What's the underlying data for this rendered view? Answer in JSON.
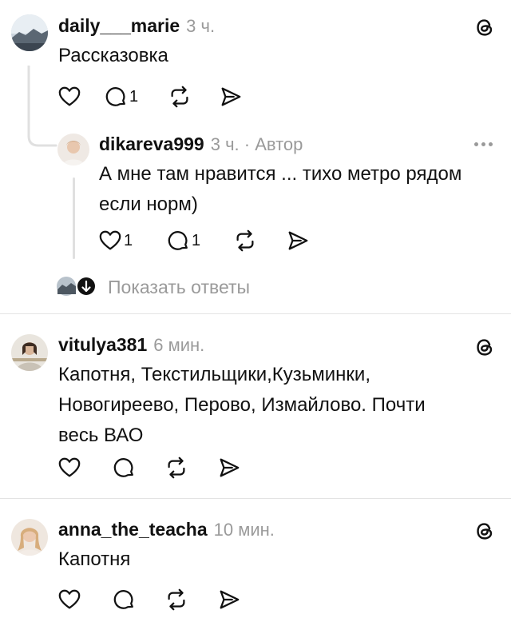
{
  "icons": {
    "like": "heart-icon",
    "comment": "speech-bubble-icon",
    "repost": "repost-arrows-icon",
    "share": "send-arrow-icon",
    "threads": "threads-logo-icon",
    "more": "more-dots-icon"
  },
  "colors": {
    "text": "#111111",
    "muted": "#9a9a9a",
    "divider": "#e3e3e3"
  },
  "posts": [
    {
      "username": "daily___marie",
      "time": "3 ч.",
      "text_lines": [
        "Рассказовка"
      ],
      "comment_count": "1"
    },
    {
      "username": "dikareva999",
      "time": "3 ч. · Автор",
      "text_lines": [
        "А мне там нравится ... тихо метро рядом",
        "если норм)"
      ],
      "like_count": "1",
      "comment_count": "1"
    },
    {
      "username": "vitulya381",
      "time": "6 мин.",
      "text_lines": [
        "Капотня, Текстильщики,Кузьминки,",
        "Новогиреево, Перово, Измайлово. Почти",
        "весь ВАО"
      ]
    },
    {
      "username": "anna_the_teacha",
      "time": "10 мин.",
      "text_lines": [
        "Капотня"
      ]
    }
  ],
  "show_replies": "Показать ответы"
}
